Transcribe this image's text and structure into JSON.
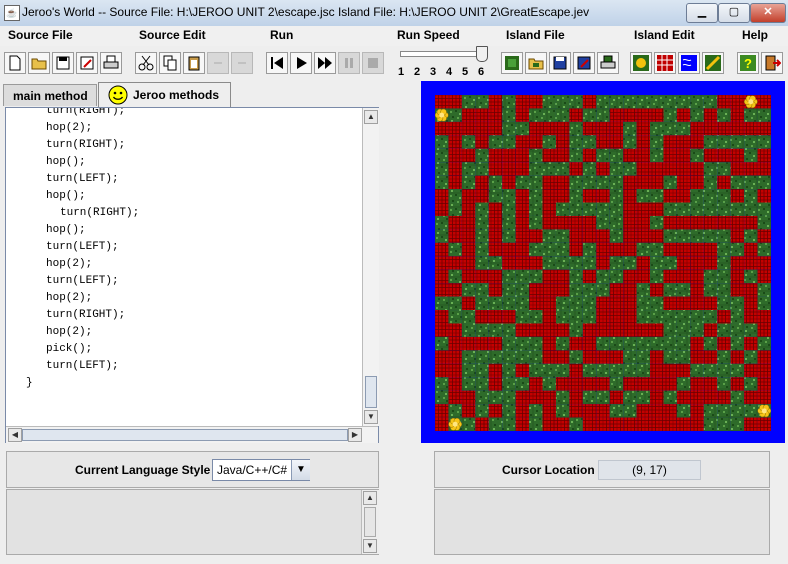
{
  "window": {
    "title": "Jeroo's World -- Source File: H:\\JEROO UNIT 2\\escape.jsc      Island File: H:\\JEROO UNIT 2\\GreatEscape.jev",
    "min_icon": "minimize-icon",
    "max_icon": "maximize-icon",
    "close_icon": "close-icon",
    "close_label": "✕"
  },
  "menu": {
    "items": [
      "Source File",
      "Source Edit",
      "Run",
      "Run Speed",
      "Island File",
      "Island Edit",
      "Help"
    ]
  },
  "toolbar": {
    "speed_labels": [
      "1",
      "2",
      "3",
      "4",
      "5",
      "6"
    ],
    "speed_value": 6
  },
  "tabs": {
    "main_method": "main method",
    "jeroo_methods": "Jeroo methods"
  },
  "code": {
    "lines": [
      {
        "indent": 1,
        "text": "turn(RIGHT);"
      },
      {
        "indent": 1,
        "text": "hop(2);"
      },
      {
        "indent": 1,
        "text": "turn(RIGHT);"
      },
      {
        "indent": 1,
        "text": "hop();"
      },
      {
        "indent": 1,
        "text": "turn(LEFT);"
      },
      {
        "indent": 1,
        "text": "hop();"
      },
      {
        "indent": 2,
        "text": "turn(RIGHT);"
      },
      {
        "indent": 1,
        "text": "hop();"
      },
      {
        "indent": 1,
        "text": "turn(LEFT);"
      },
      {
        "indent": 1,
        "text": "hop(2);"
      },
      {
        "indent": 1,
        "text": "turn(LEFT);"
      },
      {
        "indent": 1,
        "text": "hop(2);"
      },
      {
        "indent": 1,
        "text": "turn(RIGHT);"
      },
      {
        "indent": 1,
        "text": "hop(2);"
      },
      {
        "indent": 1,
        "text": "pick();"
      },
      {
        "indent": 1,
        "text": "turn(LEFT);"
      },
      {
        "indent": 0,
        "text": "}"
      }
    ]
  },
  "language": {
    "label": "Current Language Style",
    "value": "Java/C++/C#"
  },
  "cursor": {
    "label": "Cursor Location",
    "value": "(9, 17)"
  },
  "island": {
    "rows": [
      "1100101100010000000001111",
      "0011101000100111101010100",
      "1111100111011101000111111",
      "0101001101001101011100000",
      "0110111011010011011011101",
      "0100111000101001111100111",
      "0101010011000011101101000",
      "1011001011011010011000101",
      "1010101010000011100000000",
      "0110101011110011011111110",
      "0110101100111011100000101",
      "1010111000101110011110010",
      "1110011100001001001110111",
      "1011100011010011011100101",
      "1100100111000110100100110",
      "0010000110001110011110010",
      "1001110010001110000001011",
      "1100001111011111100010001",
      "0111100010110000000101010",
      "1100000011011100100110101",
      "1100101000100000111000011",
      "0100100101111011110110101",
      "0110001110100100101111011",
      "1010101010111001110100000",
      "1001001011011111111100011"
    ],
    "flowers": [
      [
        0,
        1
      ],
      [
        23,
        0
      ],
      [
        24,
        23
      ],
      [
        1,
        24
      ]
    ]
  }
}
